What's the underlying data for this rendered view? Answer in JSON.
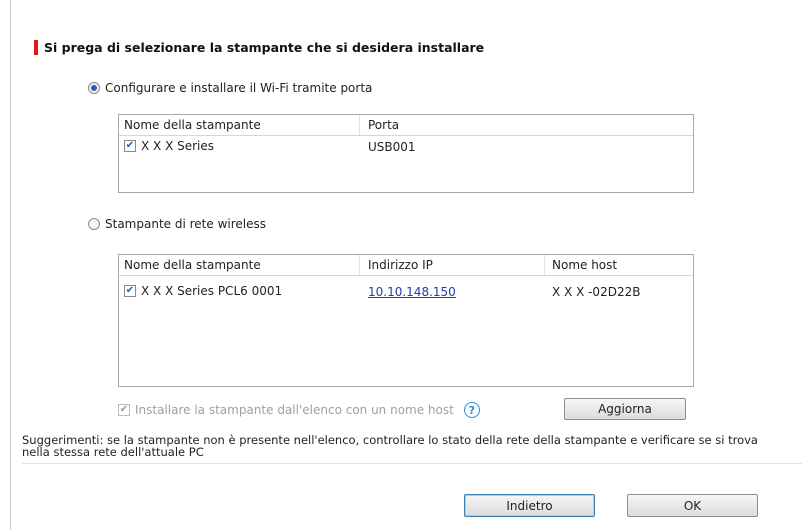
{
  "heading": "Si prega di selezionare la stampante che si desidera installare",
  "option_wifi": {
    "label": "Configurare e installare il Wi-Fi tramite porta",
    "selected": true
  },
  "usb_list": {
    "columns": [
      "Nome della stampante",
      "Porta"
    ],
    "rows": [
      {
        "checked": true,
        "name": "X X X Series",
        "port": "USB001"
      }
    ]
  },
  "option_wireless": {
    "label": "Stampante di rete wireless",
    "selected": false
  },
  "wireless_list": {
    "columns": [
      "Nome della stampante",
      "Indirizzo IP",
      "Nome host"
    ],
    "rows": [
      {
        "checked": true,
        "name": "X X X Series PCL6 0001",
        "ip": "10.10.148.150",
        "host": "X X X -02D22B"
      }
    ]
  },
  "host_option": {
    "label": "Installare la stampante dall'elenco con un nome host",
    "checked": true,
    "enabled": false
  },
  "help_icon_glyph": "?",
  "buttons": {
    "refresh": "Aggiorna",
    "back": "Indietro",
    "ok": "OK"
  },
  "hint": "Suggerimenti: se la stampante non è presente nell'elenco, controllare lo stato della rete della stampante e verificare se si trova nella stessa rete dell'attuale PC",
  "colors": {
    "heading_marker": "#e01818",
    "link": "#1a3fa8",
    "help_icon": "#2f8ad6"
  }
}
